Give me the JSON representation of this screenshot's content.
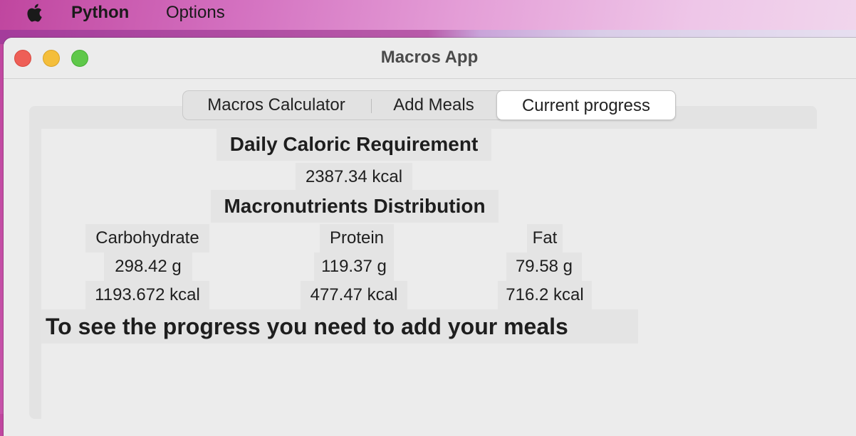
{
  "menubar": {
    "app_name": "Python",
    "options_label": "Options"
  },
  "window": {
    "title": "Macros App"
  },
  "tabs": [
    {
      "label": "Macros Calculator",
      "selected": false
    },
    {
      "label": "Add Meals",
      "selected": false
    },
    {
      "label": "Current progress",
      "selected": true
    }
  ],
  "progress": {
    "caloric_heading": "Daily Caloric Requirement",
    "caloric_value": "2387.34 kcal",
    "macros_heading": "Macronutrients Distribution",
    "columns": [
      {
        "name": "Carbohydrate",
        "grams": "298.42 g",
        "kcal": "1193.672 kcal"
      },
      {
        "name": "Protein",
        "grams": "119.37 g",
        "kcal": "477.47 kcal"
      },
      {
        "name": "Fat",
        "grams": "79.58 g",
        "kcal": "716.2 kcal"
      }
    ],
    "message": "To see the progress you need to add your meals"
  }
}
